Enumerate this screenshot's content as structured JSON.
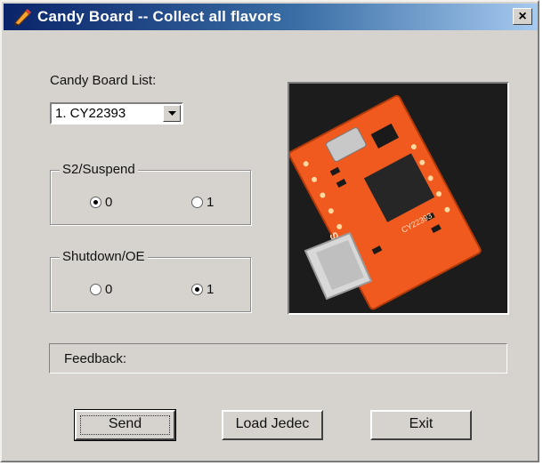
{
  "window": {
    "title": "Candy Board -- Collect all flavors",
    "close_glyph": "×"
  },
  "board_list": {
    "label": "Candy Board List:",
    "selected": "1.  CY22393"
  },
  "groups": [
    {
      "title": "S2/Suspend",
      "options": [
        "0",
        "1"
      ],
      "selected": "0"
    },
    {
      "title": "Shutdown/OE",
      "options": [
        "0",
        "1"
      ],
      "selected": "1"
    }
  ],
  "board_photo": {
    "labels": [
      "CYPRESS",
      "CY22393"
    ]
  },
  "feedback": {
    "label": "Feedback:"
  },
  "buttons": {
    "send": "Send",
    "load_jedec": "Load Jedec",
    "exit": "Exit"
  },
  "colors": {
    "dialog_bg": "#d6d3ce",
    "titlebar_start": "#0a246a",
    "titlebar_end": "#a6caf0",
    "board_orange": "#f05a1e"
  },
  "icons": {
    "app": "pencil-icon",
    "close": "close-icon",
    "dropdown": "chevron-down-icon"
  }
}
